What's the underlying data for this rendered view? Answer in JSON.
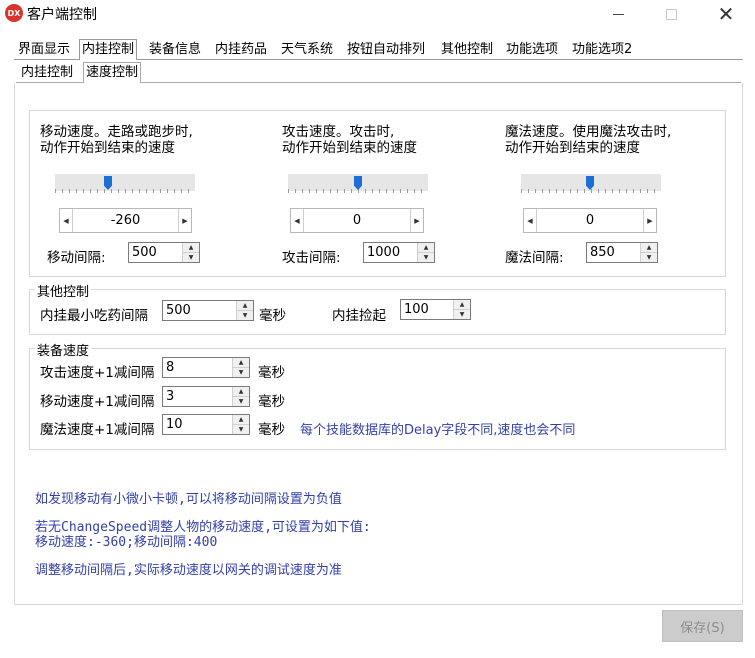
{
  "window": {
    "app_icon_text": "DX",
    "title": "客户端控制",
    "minimize_icon": "minimize-icon",
    "maximize_icon": "maximize-icon",
    "close_icon": "close-icon",
    "close_glyph": "✕"
  },
  "tabs": [
    {
      "label": "界面显示",
      "active": false
    },
    {
      "label": "内挂控制",
      "active": true
    },
    {
      "label": "装备信息",
      "active": false
    },
    {
      "label": "内挂药品",
      "active": false
    },
    {
      "label": "天气系统",
      "active": false
    },
    {
      "label": "按钮自动排列",
      "active": false
    },
    {
      "label": "其他控制",
      "active": false
    },
    {
      "label": "功能选项",
      "active": false
    },
    {
      "label": "功能选项2",
      "active": false
    }
  ],
  "subtabs": [
    {
      "label": "内挂控制",
      "active": false
    },
    {
      "label": "速度控制",
      "active": true
    }
  ],
  "speed": {
    "move": {
      "desc_line1": "移动速度。走路或跑步时,",
      "desc_line2": "动作开始到结束的速度",
      "value": "-260",
      "interval_label": "移动间隔:",
      "interval_value": "500"
    },
    "attack": {
      "desc_line1": "攻击速度。攻击时,",
      "desc_line2": "动作开始到结束的速度",
      "value": "0",
      "interval_label": "攻击间隔:",
      "interval_value": "1000"
    },
    "magic": {
      "desc_line1": "魔法速度。使用魔法攻击时,",
      "desc_line2": "动作开始到结束的速度",
      "value": "0",
      "interval_label": "魔法间隔:",
      "interval_value": "850"
    },
    "arrows": {
      "left": "◀",
      "right": "▶",
      "up": "▲",
      "down": "▼"
    }
  },
  "other_control": {
    "title": "其他控制",
    "potion_interval_label": "内挂最小吃药间隔",
    "potion_interval_value": "500",
    "ms_unit": "毫秒",
    "pickup_label": "内挂捡起",
    "pickup_value": "100"
  },
  "equip_speed": {
    "title": "装备速度",
    "rows": [
      {
        "label": "攻击速度+1减间隔",
        "value": "8",
        "unit": "毫秒"
      },
      {
        "label": "移动速度+1减间隔",
        "value": "3",
        "unit": "毫秒"
      },
      {
        "label": "魔法速度+1减间隔",
        "value": "10",
        "unit": "毫秒"
      }
    ],
    "note": "每个技能数据库的Delay字段不同,速度也会不同"
  },
  "notes": {
    "line1": "如发现移动有小微小卡顿,可以将移动间隔设置为负值",
    "line2": "若无ChangeSpeed调整人物的移动速度,可设置为如下值:",
    "line3": "移动速度:-360;移动间隔:400",
    "line4": "调整移动间隔后,实际移动速度以网关的调试速度为准"
  },
  "footer": {
    "save_label": "保存(S)"
  }
}
